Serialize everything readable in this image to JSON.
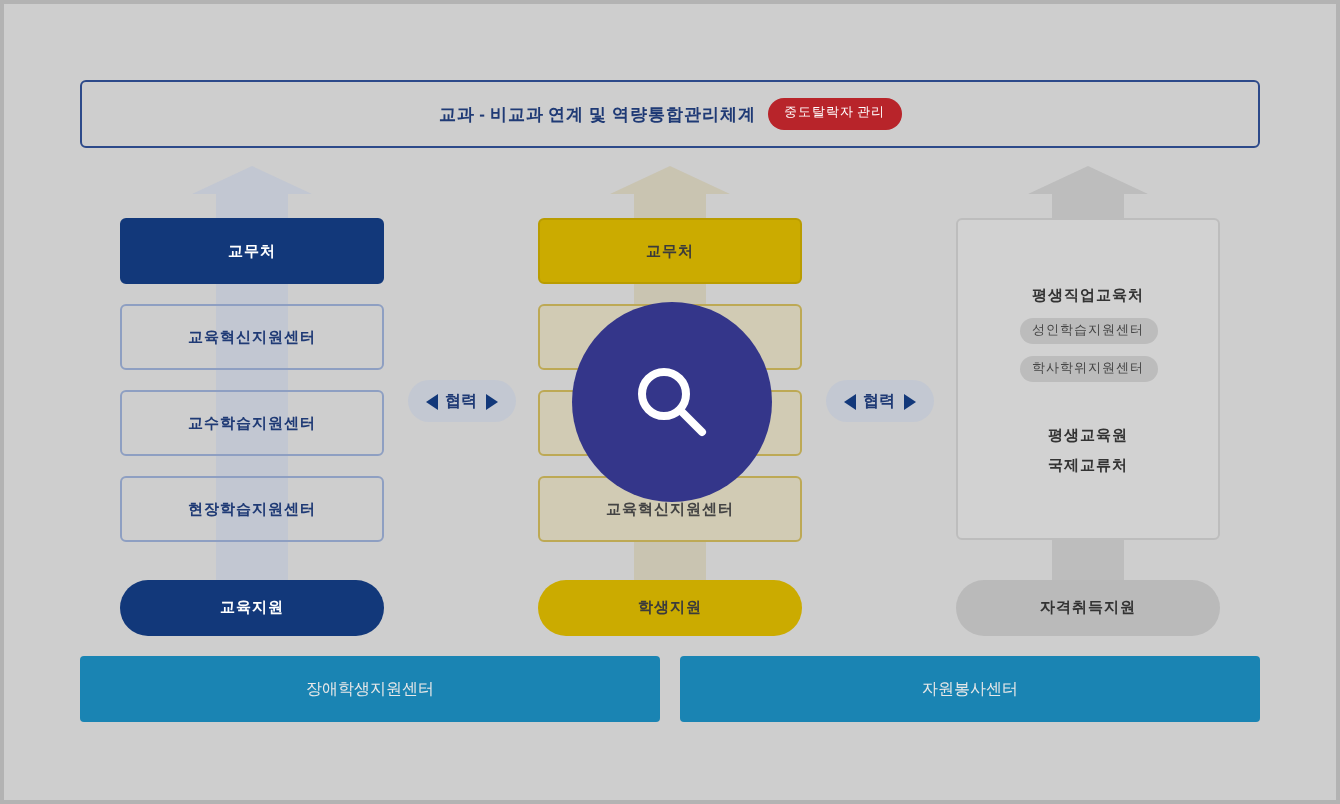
{
  "header": {
    "title": "교과 - 비교과 연계 및 역량통합관리체계",
    "badge": "중도탈락자 관리"
  },
  "columns": [
    {
      "kind": "list",
      "color": "#12387a",
      "head": "교무처",
      "items": [
        {
          "kind": "box",
          "label": "교육혁신지원센터"
        },
        {
          "kind": "box",
          "label": "교수학습지원센터"
        },
        {
          "kind": "box",
          "label": "현장학습지원센터"
        }
      ],
      "footer": "교육지원"
    },
    {
      "kind": "list",
      "color": "#cbab00",
      "head": "교무처",
      "items": [
        {
          "kind": "box"
        },
        {
          "kind": "box"
        },
        {
          "kind": "box",
          "label": "교육혁신지원센터"
        }
      ],
      "footer": "학생지원"
    },
    {
      "kind": "panel",
      "color": "#bababa",
      "title": "평생직업교육처",
      "tags": [
        "성인학습지원센터",
        "학사학위지원센터"
      ],
      "notes": [
        "평생교육원",
        "국제교류처"
      ],
      "footer": "자격취득지원"
    }
  ],
  "links": [
    "협력",
    "협력"
  ],
  "bottom_bars": [
    "장애학생지원센터",
    "자원봉사센터"
  ]
}
